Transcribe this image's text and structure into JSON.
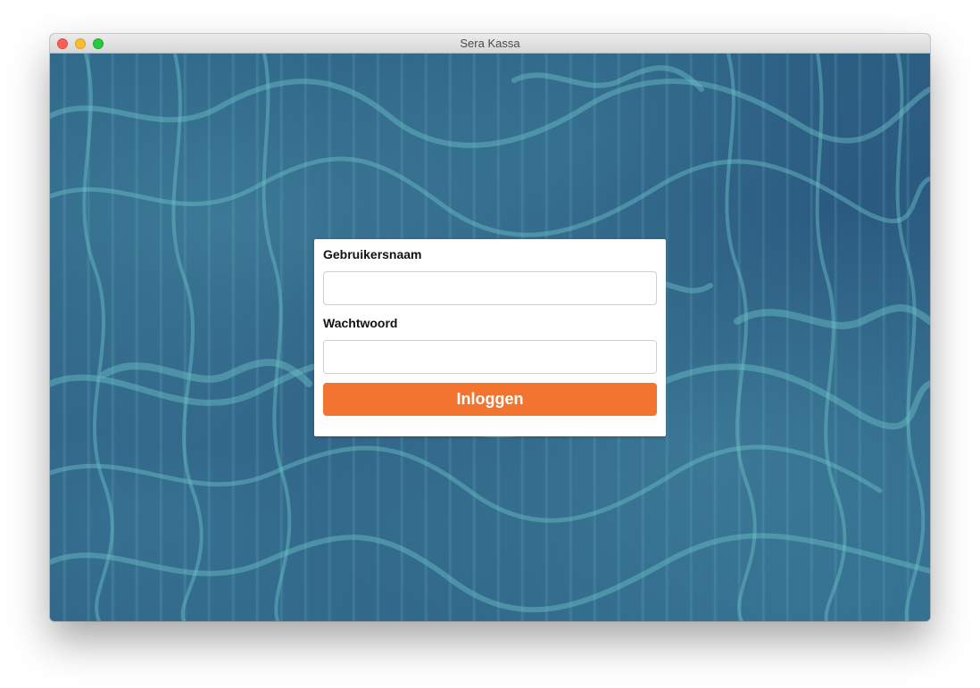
{
  "window": {
    "title": "Sera Kassa"
  },
  "login": {
    "username_label": "Gebruikersnaam",
    "username_value": "",
    "password_label": "Wachtwoord",
    "password_value": "",
    "submit_label": "Inloggen"
  },
  "colors": {
    "accent": "#f2742f",
    "background_water": "#2d5d82",
    "caustic_highlight": "#5fb0bd"
  },
  "icons": {
    "close": "traffic-light-close-icon",
    "minimize": "traffic-light-minimize-icon",
    "maximize": "traffic-light-maximize-icon"
  }
}
